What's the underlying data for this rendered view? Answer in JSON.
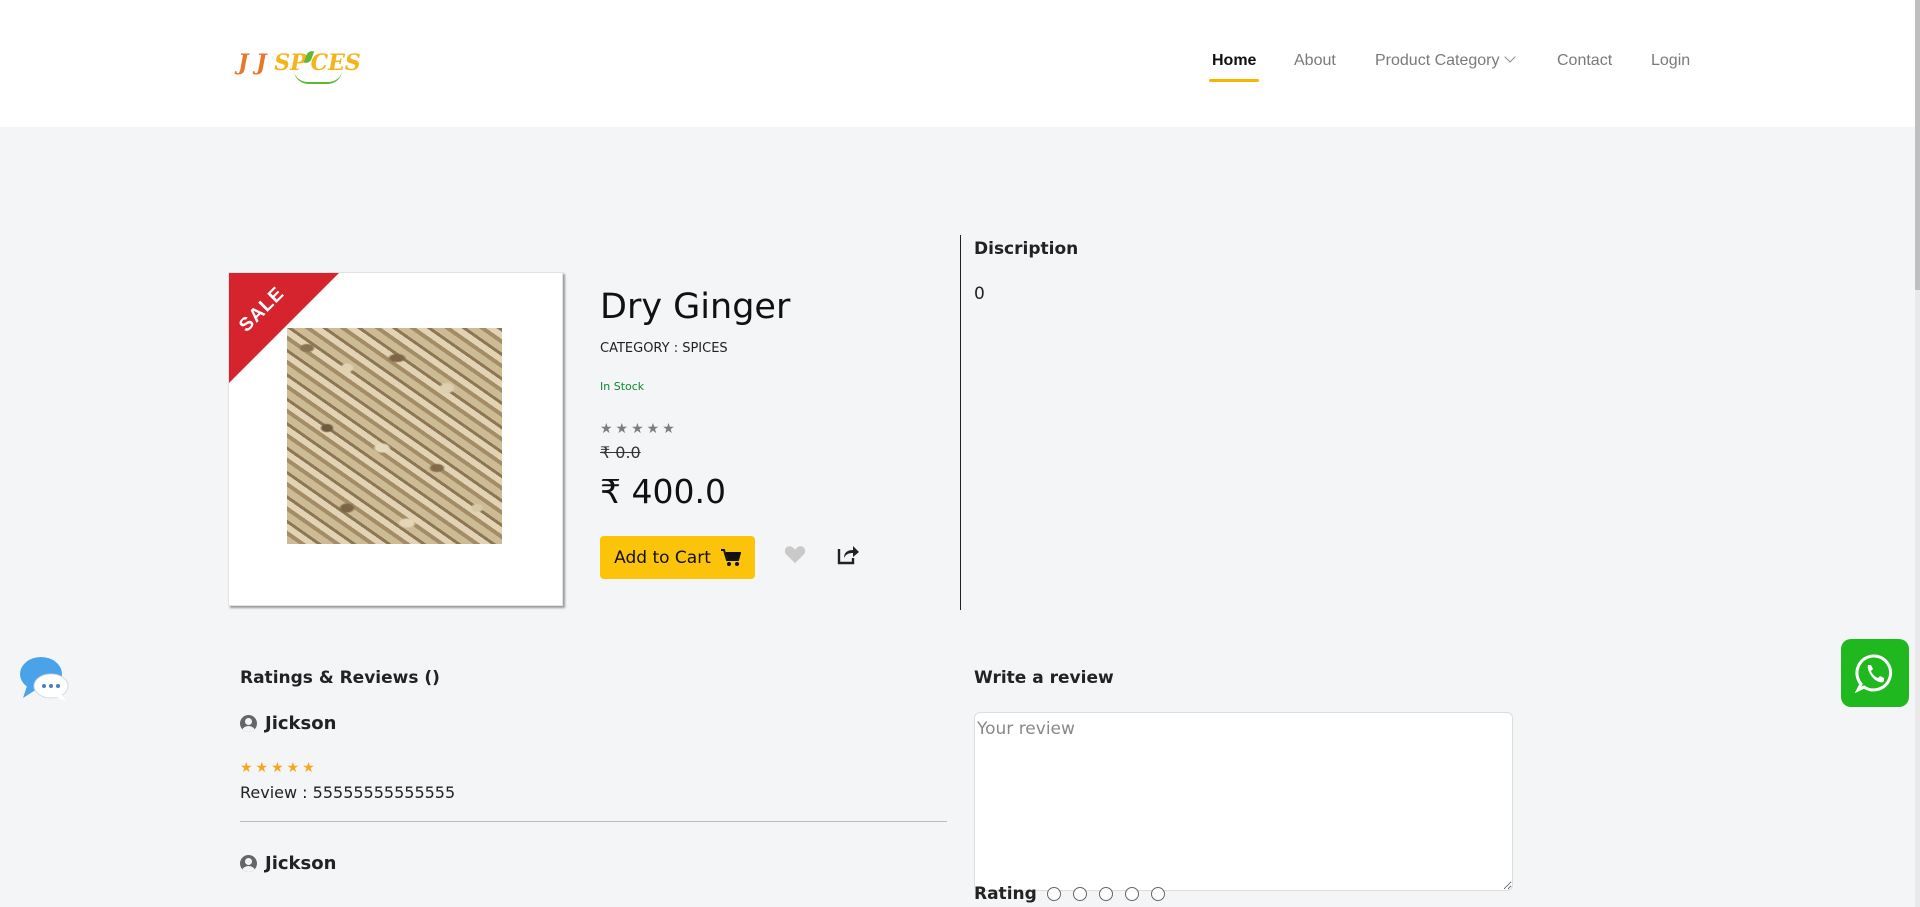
{
  "brand": {
    "logo_j1": "J",
    "logo_j2": "J",
    "logo_sp": "SP",
    "logo_ces": "CES"
  },
  "nav": {
    "home": "Home",
    "about": "About",
    "product_category": "Product Category",
    "contact": "Contact",
    "login": "Login"
  },
  "product": {
    "sale_badge": "SALE",
    "name": "Dry Ginger",
    "category": "CATEGORY : SPICES",
    "stock_status": "In Stock",
    "rating_stars": "★★★★★",
    "old_price": "₹ 0.0",
    "price": "₹ 400.0",
    "add_to_cart": "Add to Cart"
  },
  "description": {
    "title": "Discription",
    "body": "0"
  },
  "reviews": {
    "title": "Ratings & Reviews ()",
    "items": [
      {
        "user": "Jickson",
        "stars": "★★★★★",
        "text": "Review : 55555555555555"
      },
      {
        "user": "Jickson",
        "stars": "",
        "text": ""
      }
    ]
  },
  "write_review": {
    "title": "Write a review",
    "placeholder": "Your review",
    "rating_label": "Rating",
    "rating_options": 5
  },
  "colors": {
    "accent": "#fcc30b",
    "active_underline": "#f6b500",
    "sale_red": "#d6242f",
    "stock_green": "#0a8a2a",
    "review_star": "#f5a623",
    "whatsapp": "#1fb81f",
    "chat_bubble": "#4aa3e8"
  }
}
